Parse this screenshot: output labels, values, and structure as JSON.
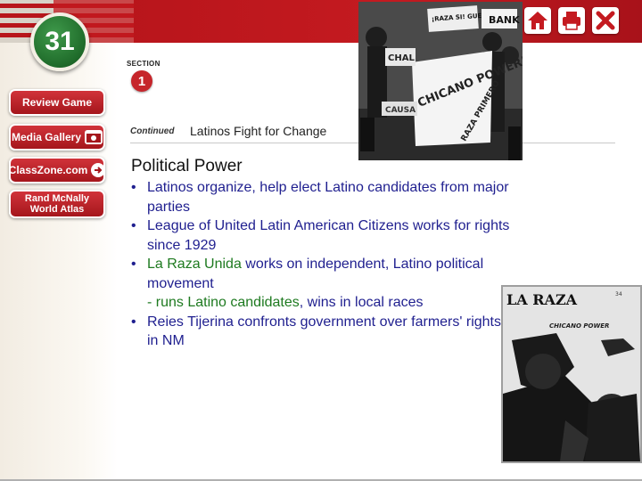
{
  "chapter": {
    "number": "31"
  },
  "sidebar": {
    "items": [
      {
        "label": "Review Game"
      },
      {
        "label": "Media Gallery"
      },
      {
        "label": "ClassZone.com"
      },
      {
        "label_line1": "Rand McNally",
        "label_line2": "World Atlas"
      }
    ]
  },
  "toolbar": {
    "home_icon": "home-icon",
    "print_icon": "printer-icon",
    "close_icon": "close-icon"
  },
  "section": {
    "label": "SECTION",
    "number": "1"
  },
  "header": {
    "continued": "Continued",
    "subtitle": "Latinos Fight for Change"
  },
  "main": {
    "heading": "Political Power",
    "bullets": [
      {
        "text": "Latinos organize, help elect Latino candidates from major parties"
      },
      {
        "text": "League of United Latin American Citizens works for rights since 1929"
      },
      {
        "highlight": "La Raza Unida",
        "text": " works on independent, Latino political movement",
        "sub_highlight": "- runs Latino candidates",
        "sub_text": ", wins in local races"
      },
      {
        "text": "Reies Tijerina confronts government over farmers' rights in NM"
      }
    ]
  },
  "photo_top": {
    "signs": [
      "¡RAZA SI! GUERRA NO!",
      "BANK",
      "CHICANO POWER!",
      "RAZA PRIMERO",
      "CHAL",
      "CAUSA"
    ]
  },
  "photo_right": {
    "title": "LA RAZA",
    "subtitle": "CHICANO POWER",
    "page": "34"
  },
  "colors": {
    "accent": "#c41a20",
    "text": "#1f1f8f",
    "highlight": "#1e7a20",
    "badge": "#1f6b2a"
  }
}
